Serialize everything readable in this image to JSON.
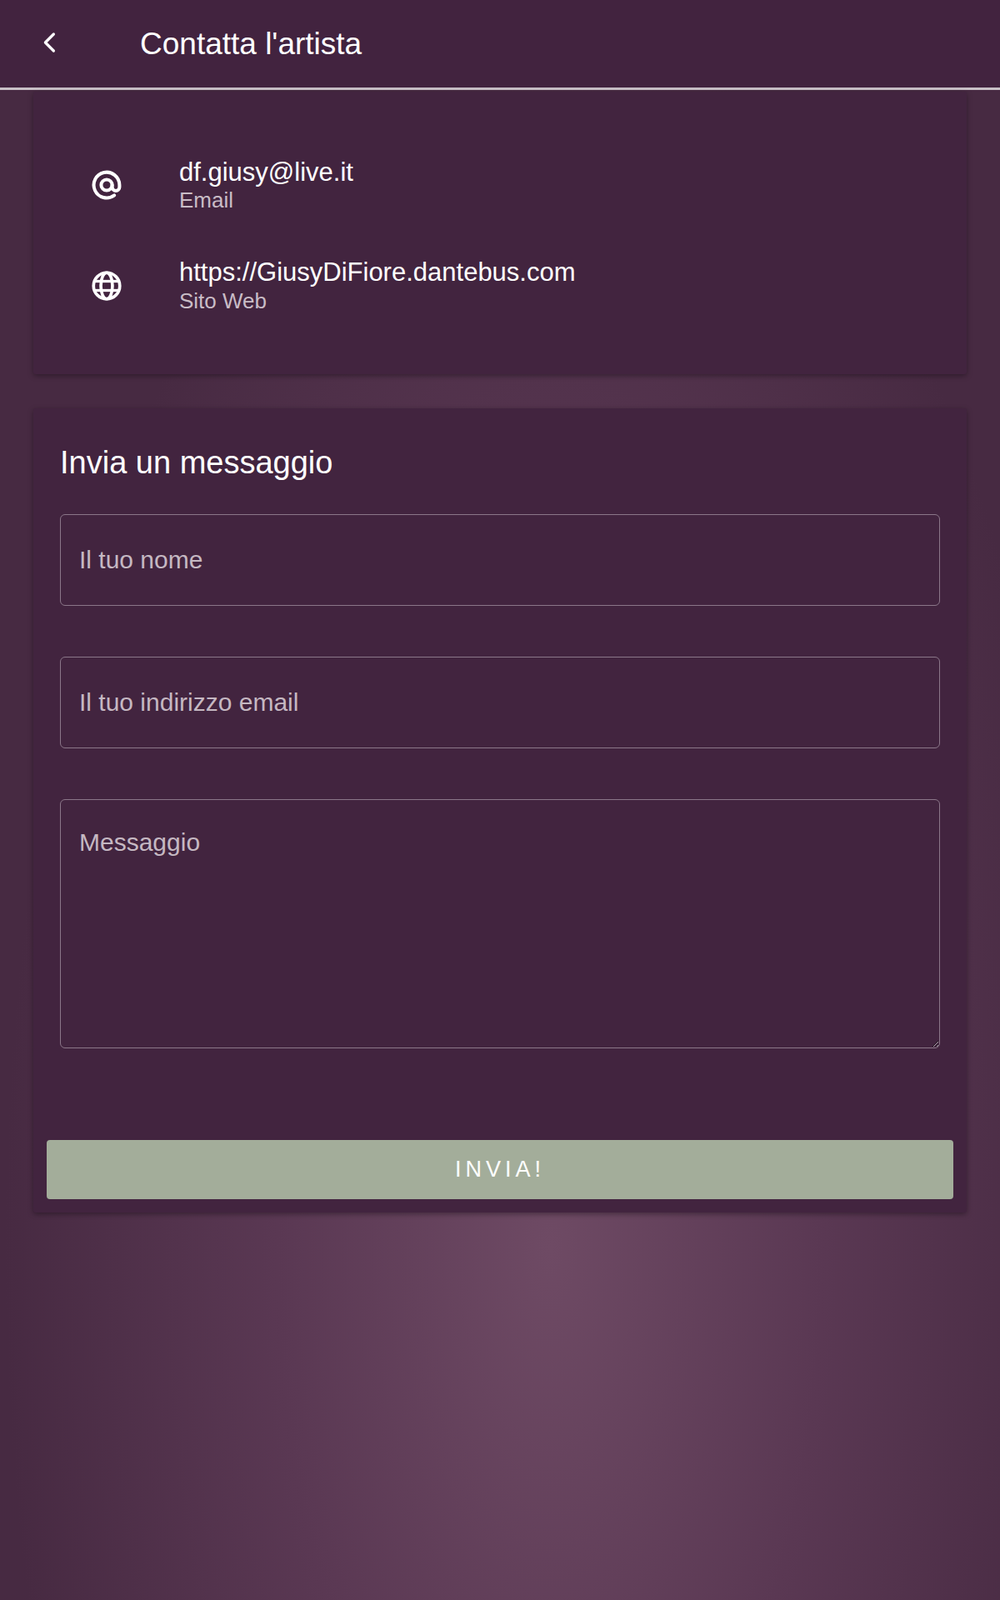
{
  "header": {
    "title": "Contatta l'artista"
  },
  "contacts": [
    {
      "kind": "email",
      "value": "df.giusy@live.it",
      "label": "Email"
    },
    {
      "kind": "web",
      "value": "https://GiusyDiFiore.dantebus.com",
      "label": "Sito Web"
    }
  ],
  "form": {
    "title": "Invia un messaggio",
    "fields": [
      {
        "kind": "input",
        "placeholder": "Il tuo nome"
      },
      {
        "kind": "input",
        "placeholder": "Il tuo indirizzo email"
      },
      {
        "kind": "textarea",
        "placeholder": "Messaggio"
      }
    ],
    "button": "INVIA!"
  }
}
